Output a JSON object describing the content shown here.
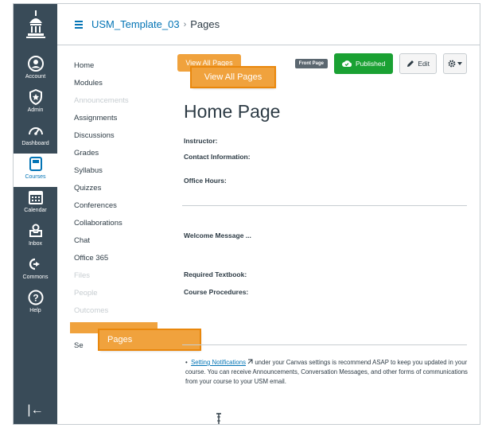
{
  "global_nav": {
    "items": [
      {
        "label": "Account",
        "icon": "account-icon"
      },
      {
        "label": "Admin",
        "icon": "admin-shield-icon"
      },
      {
        "label": "Dashboard",
        "icon": "dashboard-gauge-icon"
      },
      {
        "label": "Courses",
        "icon": "courses-book-icon",
        "active": true
      },
      {
        "label": "Calendar",
        "icon": "calendar-icon"
      },
      {
        "label": "Inbox",
        "icon": "inbox-icon"
      },
      {
        "label": "Commons",
        "icon": "commons-arrow-icon"
      },
      {
        "label": "Help",
        "icon": "help-question-icon"
      }
    ],
    "collapse_icon": "|←"
  },
  "header": {
    "course_link": "USM_Template_03",
    "separator": "›",
    "current": "Pages"
  },
  "course_nav": [
    {
      "label": "Home",
      "enabled": true
    },
    {
      "label": "Modules",
      "enabled": true
    },
    {
      "label": "Announcements",
      "enabled": false
    },
    {
      "label": "Assignments",
      "enabled": true
    },
    {
      "label": "Discussions",
      "enabled": true
    },
    {
      "label": "Grades",
      "enabled": true
    },
    {
      "label": "Syllabus",
      "enabled": true
    },
    {
      "label": "Quizzes",
      "enabled": true
    },
    {
      "label": "Conferences",
      "enabled": true
    },
    {
      "label": "Collaborations",
      "enabled": true
    },
    {
      "label": "Chat",
      "enabled": true
    },
    {
      "label": "Office 365",
      "enabled": true
    },
    {
      "label": "Files",
      "enabled": false
    },
    {
      "label": "People",
      "enabled": false
    },
    {
      "label": "Outcomes",
      "enabled": false
    },
    {
      "label": "Pa",
      "enabled": true
    },
    {
      "label": "Se",
      "enabled": true
    }
  ],
  "toolbar": {
    "view_all_under": "View All Pages",
    "front_page_badge": "Front Page",
    "published_label": "Published",
    "edit_label": "Edit"
  },
  "callouts": {
    "view_all_pages": "View All Pages",
    "pages": "Pages"
  },
  "page": {
    "title": "Home Page",
    "fields": {
      "instructor": "Instructor:",
      "contact": "Contact Information:",
      "office_hours": "Office Hours:",
      "welcome": "Welcome Message ...",
      "textbook": "Required Textbook:",
      "procedures": "Course Procedures:"
    },
    "note": {
      "bullet": "•",
      "link_text": "Setting Notifications",
      "text": " under your Canvas settings is recommend ASAP to keep you updated in your course. You can receive Announcements, Conversation Messages, and other forms of communications from your course to your USM email."
    }
  },
  "colors": {
    "nav_bg": "#394b58",
    "link": "#0374b5",
    "published": "#1aa133",
    "callout": "#f0a23d"
  }
}
